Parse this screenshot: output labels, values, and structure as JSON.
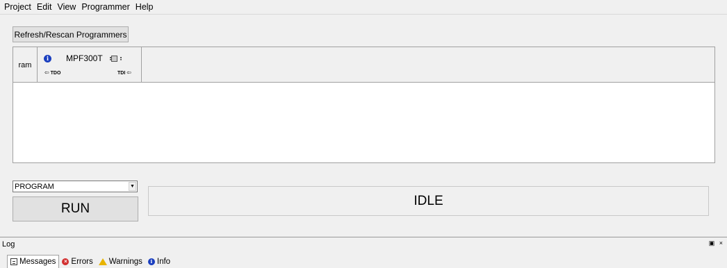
{
  "menu": [
    "Project",
    "Edit",
    "View",
    "Programmer",
    "Help"
  ],
  "toolbar": {
    "refresh_label": "Refresh/Rescan Programmers"
  },
  "chain": {
    "programmer_label": "ram",
    "device": {
      "name": "MPF300T",
      "tdo": "TDO",
      "tdi": "TDI"
    }
  },
  "action": {
    "selected": "PROGRAM",
    "run_label": "RUN"
  },
  "status": {
    "text": "IDLE"
  },
  "log": {
    "title": "Log",
    "controls": "▣ ×",
    "tabs": [
      {
        "label": "Messages",
        "icon": "messages-icon"
      },
      {
        "label": "Errors",
        "icon": "error-icon"
      },
      {
        "label": "Warnings",
        "icon": "warning-icon"
      },
      {
        "label": "Info",
        "icon": "info-icon"
      }
    ]
  }
}
